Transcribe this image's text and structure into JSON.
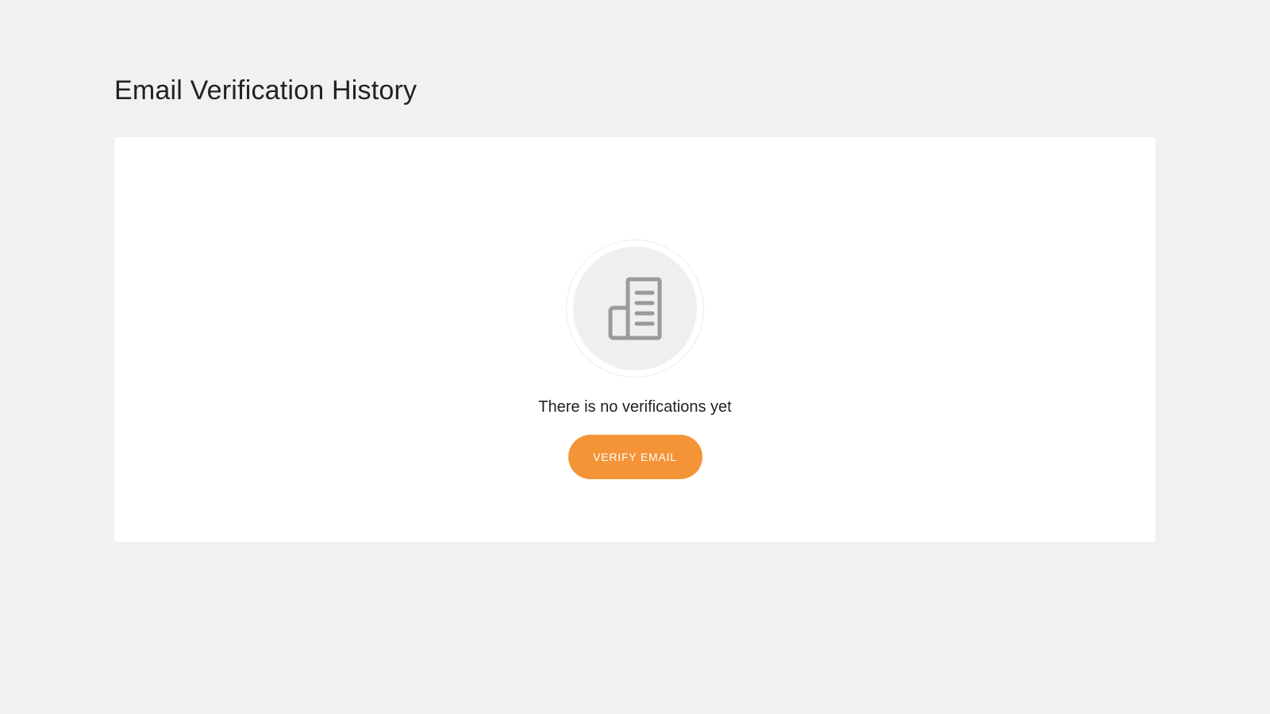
{
  "page": {
    "title": "Email Verification History"
  },
  "empty_state": {
    "icon": "document-receipt-icon",
    "message": "There is no verifications yet",
    "button_label": "VERIFY EMAIL"
  },
  "colors": {
    "background": "#f1f1f1",
    "card": "#ffffff",
    "accent": "#f49436",
    "icon": "#9a9a9a",
    "icon_circle": "#efefef"
  }
}
